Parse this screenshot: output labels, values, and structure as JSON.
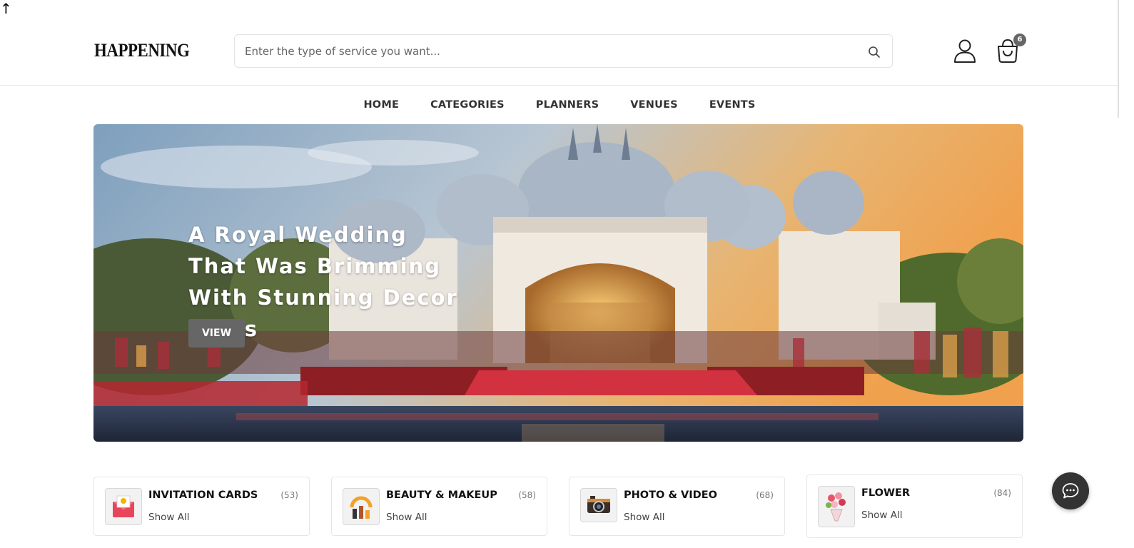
{
  "corner_glyph": "↑",
  "header": {
    "logo": "HAPPENING",
    "search_placeholder": "Enter the type of service you want...",
    "cart_count": "6"
  },
  "nav": [
    "HOME",
    "CATEGORIES",
    "PLANNERS",
    "VENUES",
    "EVENTS"
  ],
  "hero": {
    "title": "A Royal Wedding That Was Brimming With Stunning Decor Ideas",
    "button_label": "VIEW"
  },
  "categories": [
    {
      "name": "INVITATION CARDS",
      "count": "(53)",
      "link": "Show All",
      "icon": "invitation-card-icon"
    },
    {
      "name": "BEAUTY & MAKEUP",
      "count": "(58)",
      "link": "Show All",
      "icon": "makeup-icon"
    },
    {
      "name": "PHOTO & VIDEO",
      "count": "(68)",
      "link": "Show All",
      "icon": "camera-icon"
    },
    {
      "name": "FLOWER",
      "count": "(84)",
      "link": "Show All",
      "icon": "flower-bouquet-icon"
    }
  ],
  "colors": {
    "button_grey": "#666666",
    "text_dark": "#111111",
    "chat_button": "#333333"
  }
}
